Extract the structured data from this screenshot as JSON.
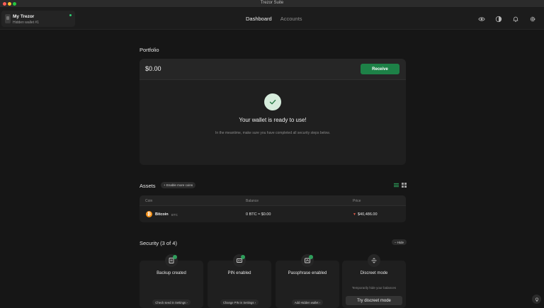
{
  "window": {
    "title": "Trezor Suite"
  },
  "wallet": {
    "name": "My Trezor",
    "subtitle": "Hidden wallet #1"
  },
  "nav": {
    "tabs": [
      {
        "label": "Dashboard",
        "active": true
      },
      {
        "label": "Accounts",
        "active": false
      }
    ],
    "icons": [
      "eye-icon",
      "tor-icon",
      "bell-icon",
      "gear-icon"
    ]
  },
  "portfolio": {
    "title": "Portfolio",
    "balance": "$0.00",
    "receive_label": "Receive",
    "ready_title": "Your wallet is ready to use!",
    "ready_subtitle": "In the meantime, make sure you have completed all security steps below."
  },
  "assets": {
    "title": "Assets",
    "enable_coins_label": "+ Enable more coins",
    "columns": [
      "Coin",
      "Balance",
      "Price"
    ],
    "rows": [
      {
        "name": "Bitcoin",
        "symbol": "BTC",
        "balance": "0 BTC ≈ $0.00",
        "price": "$40,486.00",
        "trend": "down"
      }
    ]
  },
  "security": {
    "title": "Security (3 of 4)",
    "hide_label": "– Hide",
    "cards": [
      {
        "title": "Backup created",
        "action": "Check seed in Settings ›",
        "done": true
      },
      {
        "title": "PIN enabled",
        "action": "Change PIN in Settings ›",
        "done": true
      },
      {
        "title": "Passphrase enabled",
        "action": "Add Hidden wallet ›",
        "done": true
      },
      {
        "title": "Discreet mode",
        "subtitle": "Temporarily hide your balances",
        "action": "Try discreet mode",
        "done": false
      }
    ]
  },
  "colors": {
    "accent": "#1d8147",
    "background": "#161616",
    "card": "#1f1f1f",
    "bitcoin": "#f7931a",
    "negative": "#e05a4a"
  }
}
